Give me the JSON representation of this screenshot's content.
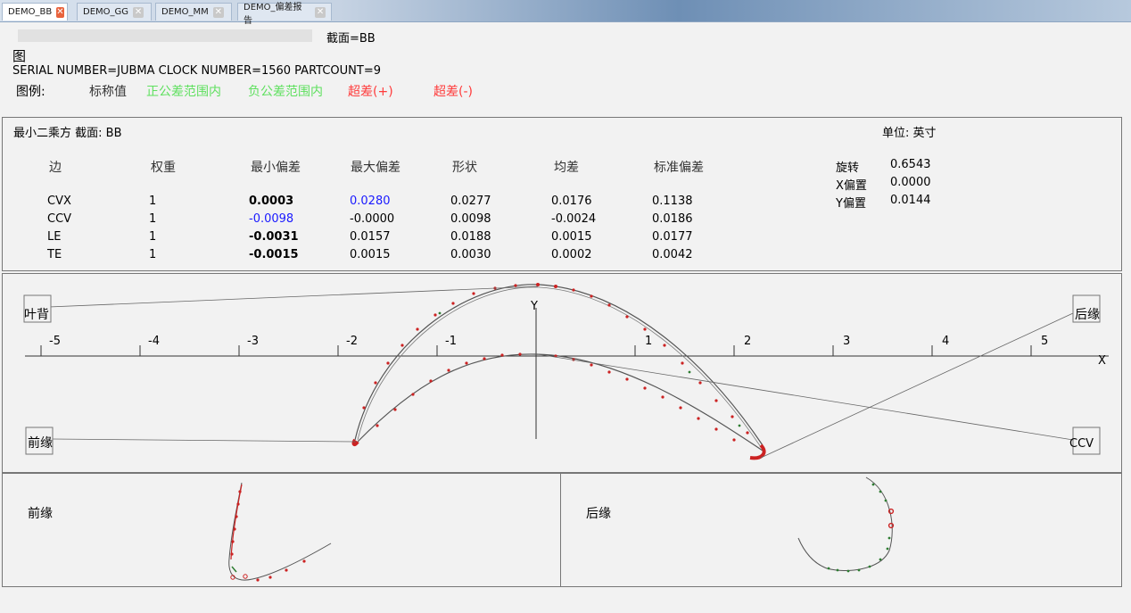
{
  "tabs": [
    {
      "label": "DEMO_BB",
      "active": true
    },
    {
      "label": "DEMO_GG",
      "active": false
    },
    {
      "label": "DEMO_MM",
      "active": false
    },
    {
      "label": "DEMO_偏差报告",
      "active": false
    }
  ],
  "header": {
    "section_label": "截面=BB",
    "figure_label": "图",
    "serial_line": "SERIAL NUMBER=JUBMA CLOCK NUMBER=1560 PARTCOUNT=9",
    "legend_title": "图例:",
    "legend_items": [
      {
        "label": "标称值",
        "color": "#333333"
      },
      {
        "label": "正公差范围内",
        "color": "#5fe05f"
      },
      {
        "label": "负公差范围内",
        "color": "#5fe05f"
      },
      {
        "label": "超差(+)",
        "color": "#ff3b3b"
      },
      {
        "label": "超差(-)",
        "color": "#ff3b3b"
      }
    ]
  },
  "stats": {
    "title": "最小二乘方 截面: BB",
    "unit": "单位: 英寸",
    "columns": [
      "边",
      "权重",
      "最小偏差",
      "最大偏差",
      "形状",
      "均差",
      "标准偏差"
    ],
    "rows": [
      {
        "edge": "CVX",
        "weight": "1",
        "min": "0.0003",
        "max": "0.0280",
        "form": "0.0277",
        "mean": "0.0176",
        "std": "0.1138"
      },
      {
        "edge": "CCV",
        "weight": "1",
        "min": "-0.0098",
        "max": "-0.0000",
        "form": "0.0098",
        "mean": "-0.0024",
        "std": "0.0186"
      },
      {
        "edge": "LE",
        "weight": "1",
        "min": "-0.0031",
        "max": "0.0157",
        "form": "0.0188",
        "mean": "0.0015",
        "std": "0.0177"
      },
      {
        "edge": "TE",
        "weight": "1",
        "min": "-0.0015",
        "max": "0.0015",
        "form": "0.0030",
        "mean": "0.0002",
        "std": "0.0042"
      }
    ],
    "transform": [
      {
        "label": "旋转",
        "value": "0.6543"
      },
      {
        "label": "X偏置",
        "value": "0.0000"
      },
      {
        "label": "Y偏置",
        "value": "0.0144"
      }
    ]
  },
  "profile": {
    "x_axis_label": "X",
    "y_axis_label": "Y",
    "tick_labels": [
      "-5",
      "-4",
      "-3",
      "-2",
      "-1",
      "1",
      "2",
      "3",
      "4",
      "5"
    ],
    "callouts": {
      "convex": "叶背",
      "leading": "前缘",
      "trailing": "后缘",
      "concave": "CCV"
    }
  },
  "detail": {
    "leading_label": "前缘",
    "trailing_label": "后缘"
  },
  "colors": {
    "nominal": "#555555",
    "out_tolerance": "#cc2222",
    "in_tolerance": "#2e7d32",
    "highlight_blue": "#1a1aff"
  }
}
